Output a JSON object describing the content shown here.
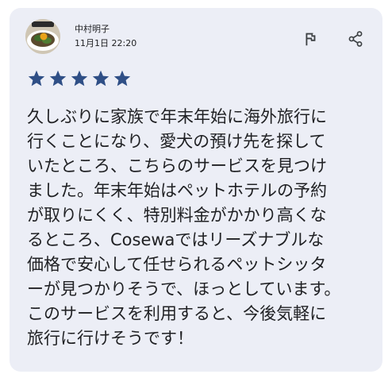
{
  "review": {
    "author_name": "中村明子",
    "date": "11月1日 22:20",
    "rating": 5,
    "max_rating": 5,
    "star_color": "#2f4f86",
    "icons": {
      "report": "flag-icon",
      "share": "share-icon"
    },
    "lines": [
      "久しぶりに家族で年末年始に海外旅行に",
      "行くことになり、愛犬の預け先を探して",
      "いたところ、こちらのサービスを見つけ",
      "ました。年末年始はペットホテルの予約",
      "が取りにくく、特別料金がかかり高くな",
      "るところ、Cosewaではリーズナブルな",
      "価格で安心して任せられるペットシッタ",
      "ーが見つかりそうで、ほっとしています。",
      "このサービスを利用すると、今後気軽に",
      "旅行に行けそうです！"
    ]
  }
}
